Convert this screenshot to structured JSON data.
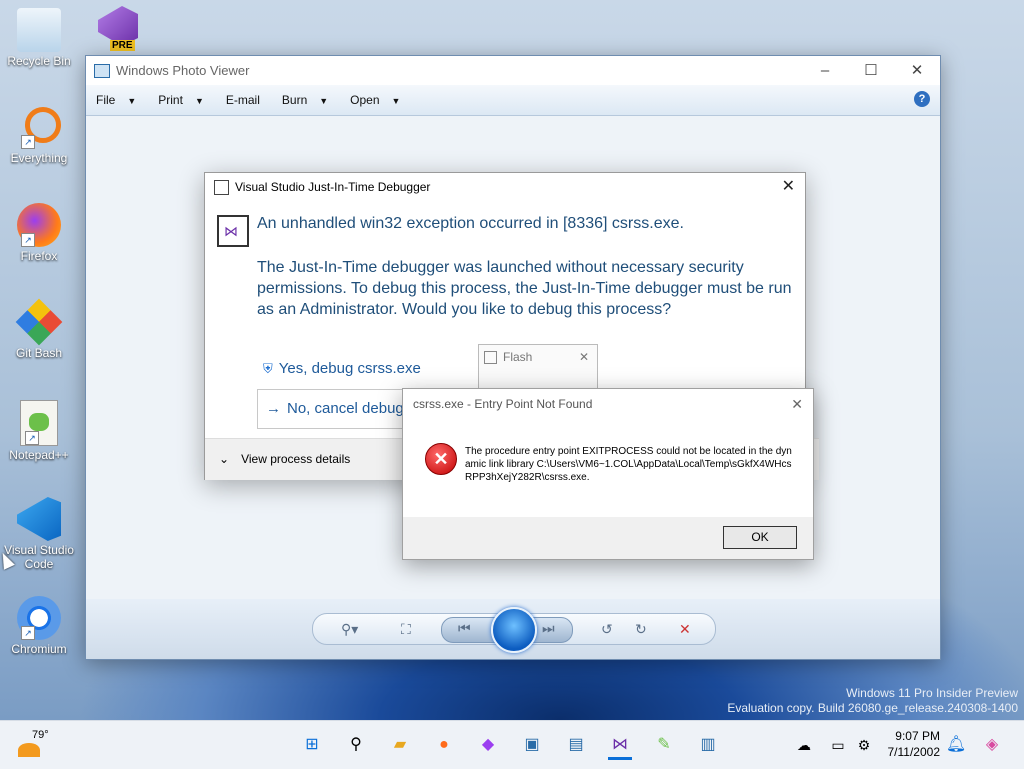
{
  "desktop": {
    "icons": [
      {
        "label": "Recycle Bin"
      },
      {
        "label": "Everything"
      },
      {
        "label": "Firefox"
      },
      {
        "label": "Git Bash"
      },
      {
        "label": "Notepad++"
      },
      {
        "label": "Visual Studio Code"
      },
      {
        "label": "Chromium"
      }
    ],
    "vs_badge": "PRE",
    "watermark_line1": "Windows 11 Pro Insider Preview",
    "watermark_line2": "Evaluation copy. Build 26080.ge_release.240308-1400"
  },
  "photo_viewer": {
    "title": "Windows Photo Viewer",
    "menu": [
      "File",
      "Print",
      "E-mail",
      "Burn",
      "Open"
    ],
    "help": "?"
  },
  "jit_dialog": {
    "title": "Visual Studio Just-In-Time Debugger",
    "heading": "An unhandled win32 exception occurred in [8336] csrss.exe.",
    "body": "The Just-In-Time debugger was launched without necessary security permissions. To debug this process, the Just-In-Time debugger must be run as an Administrator. Would you like to debug this process?",
    "yes_label": "Yes, debug csrss.exe",
    "no_label": "No, cancel debugging",
    "details_label": "View process details"
  },
  "flash_window": {
    "title": "Flash"
  },
  "error_dialog": {
    "title": "csrss.exe - Entry Point Not Found",
    "message": "The procedure entry point EXITPROCESS could not be located in the dynamic link library C:\\Users\\VM6~1.COL\\AppData\\Local\\Temp\\sGkfX4WHcsRPP3hXejY282R\\csrss.exe.",
    "ok_label": "OK"
  },
  "taskbar": {
    "temperature": "79°",
    "time": "9:07 PM",
    "date": "7/11/2002"
  },
  "colors": {
    "accent": "#1e5a9a",
    "error": "#c10000"
  }
}
